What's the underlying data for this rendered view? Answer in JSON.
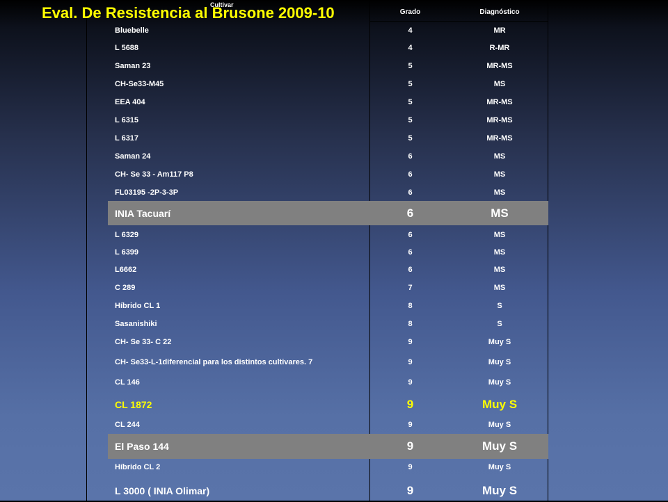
{
  "title": "Eval. De Resistencia al Brusone 2009-10",
  "headers": {
    "cultivar": "Cultivar",
    "grado": "Grado",
    "diagnostico": "Diagnóstico"
  },
  "rows": [
    {
      "cultivar": "Bluebelle",
      "grado": "4",
      "diag": "MR"
    },
    {
      "cultivar": "L 5688",
      "grado": "4",
      "diag": "R-MR"
    },
    {
      "cultivar": "Saman 23",
      "grado": "5",
      "diag": "MR-MS"
    },
    {
      "cultivar": "CH-Se33-M45",
      "grado": "5",
      "diag": "MS"
    },
    {
      "cultivar": "EEA 404",
      "grado": "5",
      "diag": "MR-MS"
    },
    {
      "cultivar": "L 6315",
      "grado": "5",
      "diag": "MR-MS"
    },
    {
      "cultivar": "L 6317",
      "grado": "5",
      "diag": "MR-MS"
    },
    {
      "cultivar": "Saman 24",
      "grado": "6",
      "diag": "MS"
    },
    {
      "cultivar": "CH- Se 33 - Am117 P8",
      "grado": "6",
      "diag": "MS"
    },
    {
      "cultivar": "FL03195 -2P-3-3P",
      "grado": "6",
      "diag": "MS"
    },
    {
      "cultivar": "INIA Tacuarí",
      "grado": "6",
      "diag": "MS"
    },
    {
      "cultivar": "L 6329",
      "grado": "6",
      "diag": "MS"
    },
    {
      "cultivar": "L 6399",
      "grado": "6",
      "diag": "MS"
    },
    {
      "cultivar": "L6662",
      "grado": "6",
      "diag": "MS"
    },
    {
      "cultivar": "C 289",
      "grado": "7",
      "diag": "MS"
    },
    {
      "cultivar": "Híbrido CL 1",
      "grado": "8",
      "diag": "S"
    },
    {
      "cultivar": "Sasanishiki",
      "grado": "8",
      "diag": "S"
    },
    {
      "cultivar": "CH- Se 33- C 22",
      "grado": "9",
      "diag": "Muy S"
    },
    {
      "cultivar": "CH- Se33-L-1diferencial  para los distintos cultivares. 7",
      "grado": "9",
      "diag": "Muy S"
    },
    {
      "cultivar": "CL 146",
      "grado": "9",
      "diag": "Muy S"
    },
    {
      "cultivar": "CL 1872",
      "grado": "9",
      "diag": "Muy S"
    },
    {
      "cultivar": "CL 244",
      "grado": "9",
      "diag": "Muy S"
    },
    {
      "cultivar": "El Paso 144",
      "grado": "9",
      "diag": "Muy S"
    },
    {
      "cultivar": "Híbrido CL 2",
      "grado": "9",
      "diag": "Muy S"
    },
    {
      "cultivar": "L 3000 ( INIA Olimar)",
      "grado": "9",
      "diag": "Muy S"
    }
  ],
  "colors": {
    "title": "#ffff00",
    "highlight_row": "#808080",
    "text": "#ffffff",
    "emphasis": "#ffff00"
  }
}
